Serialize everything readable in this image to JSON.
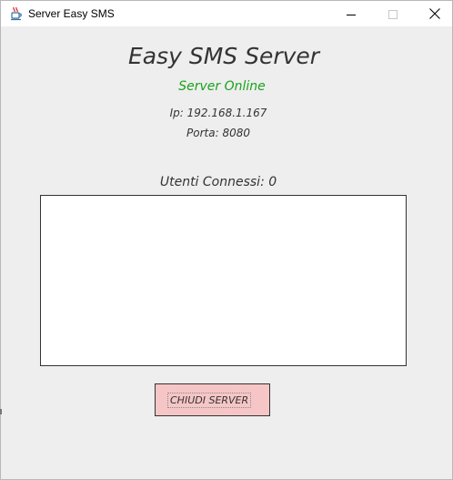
{
  "window": {
    "title": "Server Easy SMS",
    "icon": "java-cup-icon"
  },
  "main": {
    "app_title": "Easy SMS Server",
    "status": "Server Online",
    "status_color": "#1aa31a",
    "ip": "Ip: 192.168.1.167",
    "port": "Porta: 8080",
    "users_connected": "Utenti Connessi: 0",
    "users_list": [],
    "close_button_label": "CHIUDI SERVER",
    "close_button_color": "#f6c6c6"
  }
}
